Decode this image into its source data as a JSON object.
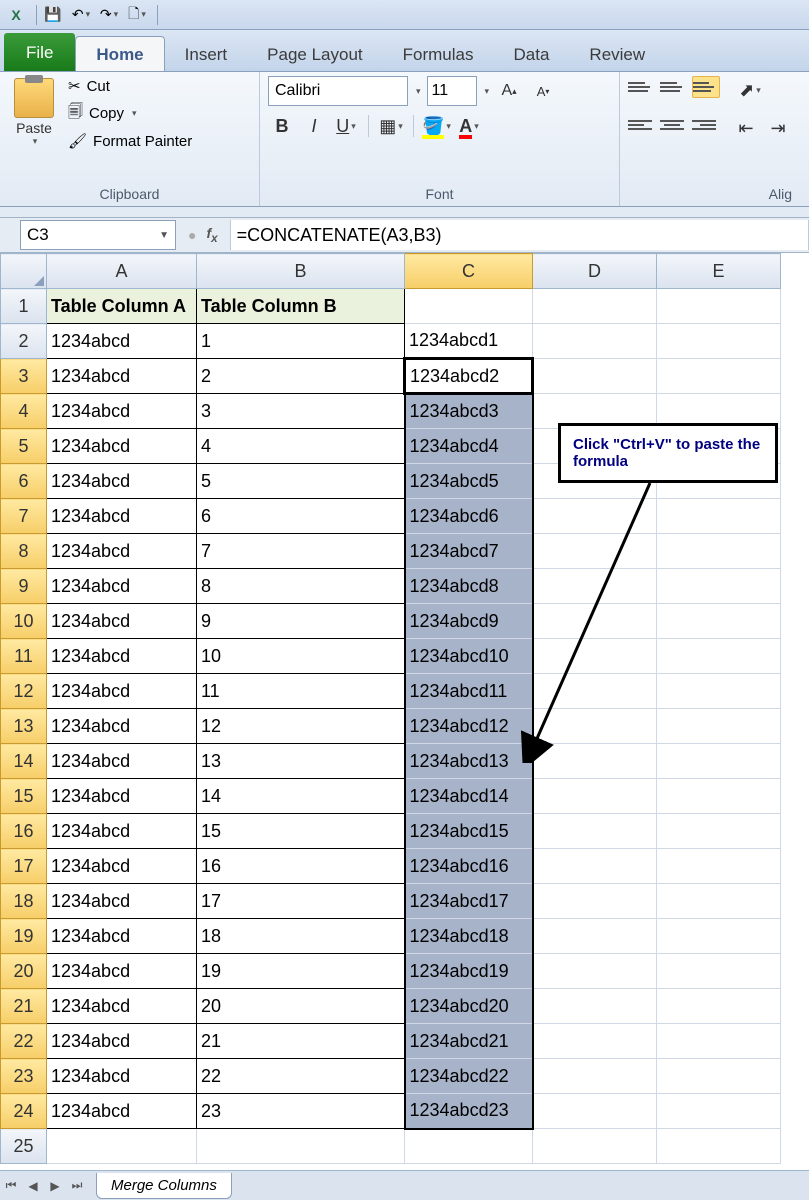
{
  "qat": {},
  "tabs": {
    "file": "File",
    "home": "Home",
    "insert": "Insert",
    "pagelayout": "Page Layout",
    "formulas": "Formulas",
    "data": "Data",
    "review": "Review"
  },
  "ribbon": {
    "clipboard": {
      "paste": "Paste",
      "cut": "Cut",
      "copy": "Copy",
      "format_painter": "Format Painter",
      "group_label": "Clipboard"
    },
    "font": {
      "name": "Calibri",
      "size": "11",
      "group_label": "Font"
    },
    "alignment": {
      "group_label": "Alig"
    }
  },
  "namebox": "C3",
  "formula": "=CONCATENATE(A3,B3)",
  "columns": [
    "A",
    "B",
    "C",
    "D",
    "E"
  ],
  "headers": {
    "a": "Table Column A",
    "b": "Table Column B"
  },
  "rows": [
    {
      "n": "1",
      "a": "Table Column A",
      "b": "Table Column B",
      "c": "",
      "hdr": true
    },
    {
      "n": "2",
      "a": "1234abcd",
      "b": "1",
      "c": "1234abcd1"
    },
    {
      "n": "3",
      "a": "1234abcd",
      "b": "2",
      "c": "1234abcd2"
    },
    {
      "n": "4",
      "a": "1234abcd",
      "b": "3",
      "c": "1234abcd3"
    },
    {
      "n": "5",
      "a": "1234abcd",
      "b": "4",
      "c": "1234abcd4"
    },
    {
      "n": "6",
      "a": "1234abcd",
      "b": "5",
      "c": "1234abcd5"
    },
    {
      "n": "7",
      "a": "1234abcd",
      "b": "6",
      "c": "1234abcd6"
    },
    {
      "n": "8",
      "a": "1234abcd",
      "b": "7",
      "c": "1234abcd7"
    },
    {
      "n": "9",
      "a": "1234abcd",
      "b": "8",
      "c": "1234abcd8"
    },
    {
      "n": "10",
      "a": "1234abcd",
      "b": "9",
      "c": "1234abcd9"
    },
    {
      "n": "11",
      "a": "1234abcd",
      "b": "10",
      "c": "1234abcd10"
    },
    {
      "n": "12",
      "a": "1234abcd",
      "b": "11",
      "c": "1234abcd11"
    },
    {
      "n": "13",
      "a": "1234abcd",
      "b": "12",
      "c": "1234abcd12"
    },
    {
      "n": "14",
      "a": "1234abcd",
      "b": "13",
      "c": "1234abcd13"
    },
    {
      "n": "15",
      "a": "1234abcd",
      "b": "14",
      "c": "1234abcd14"
    },
    {
      "n": "16",
      "a": "1234abcd",
      "b": "15",
      "c": "1234abcd15"
    },
    {
      "n": "17",
      "a": "1234abcd",
      "b": "16",
      "c": "1234abcd16"
    },
    {
      "n": "18",
      "a": "1234abcd",
      "b": "17",
      "c": "1234abcd17"
    },
    {
      "n": "19",
      "a": "1234abcd",
      "b": "18",
      "c": "1234abcd18"
    },
    {
      "n": "20",
      "a": "1234abcd",
      "b": "19",
      "c": "1234abcd19"
    },
    {
      "n": "21",
      "a": "1234abcd",
      "b": "20",
      "c": "1234abcd20"
    },
    {
      "n": "22",
      "a": "1234abcd",
      "b": "21",
      "c": "1234abcd21"
    },
    {
      "n": "23",
      "a": "1234abcd",
      "b": "22",
      "c": "1234abcd22"
    },
    {
      "n": "24",
      "a": "1234abcd",
      "b": "23",
      "c": "1234abcd23"
    },
    {
      "n": "25",
      "a": "",
      "b": "",
      "c": ""
    }
  ],
  "callout": "Click \"Ctrl+V\" to paste the formula",
  "sheet_tab": "Merge Columns",
  "col_widths": {
    "rowhdr": 46,
    "A": 150,
    "B": 208,
    "C": 128,
    "D": 124,
    "E": 124
  }
}
